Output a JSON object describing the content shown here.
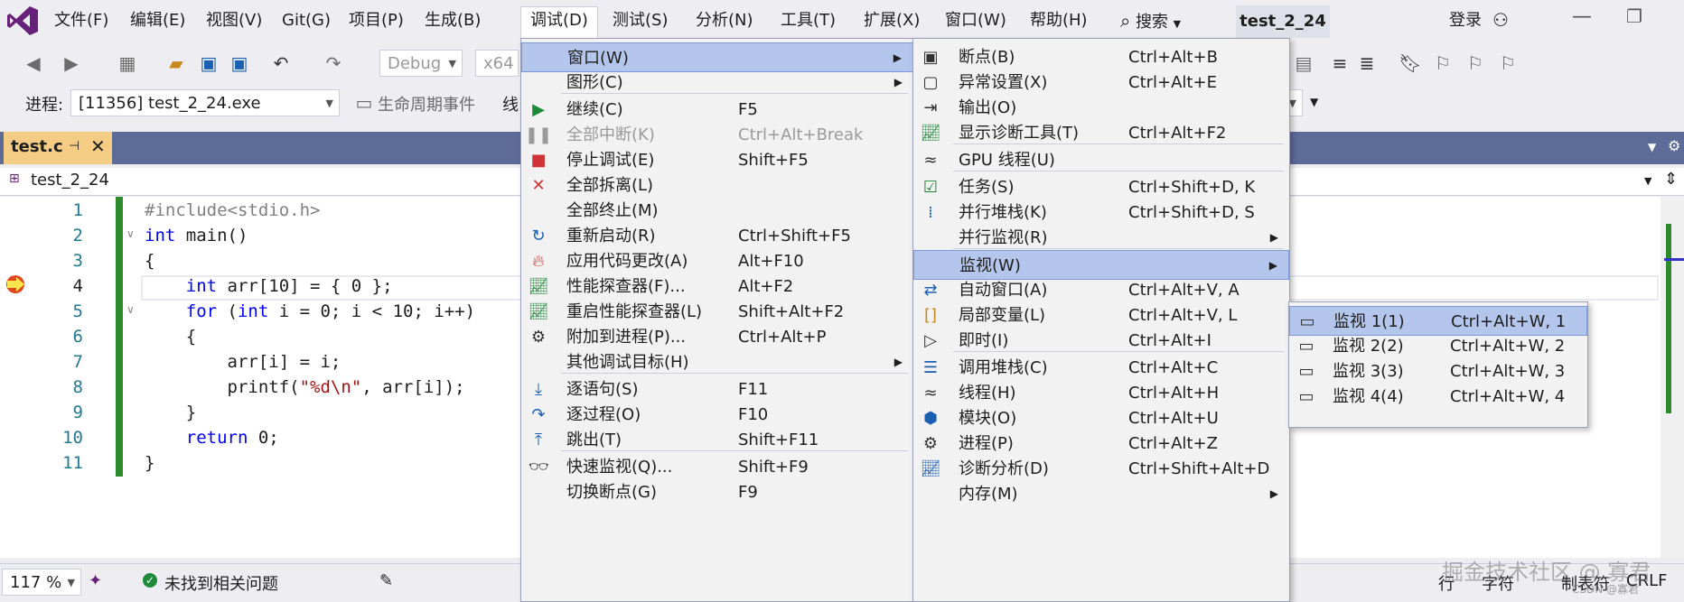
{
  "menubar": {
    "items": [
      "文件(F)",
      "编辑(E)",
      "视图(V)",
      "Git(G)",
      "项目(P)",
      "生成(B)",
      "调试(D)",
      "测试(S)",
      "分析(N)",
      "工具(T)",
      "扩展(X)",
      "窗口(W)",
      "帮助(H)"
    ],
    "search": "搜索",
    "title": "test_2_24",
    "login": "登录"
  },
  "toolbar": {
    "config": "Debug",
    "platform": "x64",
    "process_label": "进程:",
    "process": "[11356] test_2_24.exe",
    "lifecycle": "生命周期事件",
    "thread_label": "线"
  },
  "tab": {
    "title": "test.c"
  },
  "nav": {
    "scope": "test_2_24"
  },
  "code": {
    "line_numbers": [
      "1",
      "2",
      "3",
      "4",
      "5",
      "6",
      "7",
      "8",
      "9",
      "10",
      "11"
    ]
  },
  "status": {
    "zoom": "117 %",
    "issues": "未找到相关问题",
    "right_text": "行",
    "right_text2": "字符",
    "right_text3": "制表符",
    "eol": "CRLF",
    "watermark": "掘金技术社区 @ 寡君",
    "watermark2": "CSDN @寡君"
  },
  "debug_menu": {
    "items": [
      {
        "label": "窗口(W)",
        "shortcut": "",
        "icon": "",
        "submenu": true
      },
      {
        "label": "图形(C)",
        "shortcut": "",
        "icon": "",
        "submenu": true
      },
      {
        "label": "继续(C)",
        "shortcut": "F5",
        "icon": "play-icon"
      },
      {
        "label": "全部中断(K)",
        "shortcut": "Ctrl+Alt+Break",
        "icon": "pause-icon",
        "disabled": true
      },
      {
        "label": "停止调试(E)",
        "shortcut": "Shift+F5",
        "icon": "stop-icon"
      },
      {
        "label": "全部拆离(L)",
        "shortcut": "",
        "icon": "detach-icon"
      },
      {
        "label": "全部终止(M)",
        "shortcut": "",
        "icon": ""
      },
      {
        "label": "重新启动(R)",
        "shortcut": "Ctrl+Shift+F5",
        "icon": "restart-icon"
      },
      {
        "label": "应用代码更改(A)",
        "shortcut": "Alt+F10",
        "icon": "hot-reload-icon"
      },
      {
        "label": "性能探查器(F)...",
        "shortcut": "Alt+F2",
        "icon": "profiler-icon"
      },
      {
        "label": "重启性能探查器(L)",
        "shortcut": "Shift+Alt+F2",
        "icon": "profiler-icon"
      },
      {
        "label": "附加到进程(P)...",
        "shortcut": "Ctrl+Alt+P",
        "icon": "attach-icon"
      },
      {
        "label": "其他调试目标(H)",
        "shortcut": "",
        "icon": "",
        "submenu": true
      },
      {
        "label": "逐语句(S)",
        "shortcut": "F11",
        "icon": "step-into-icon"
      },
      {
        "label": "逐过程(O)",
        "shortcut": "F10",
        "icon": "step-over-icon"
      },
      {
        "label": "跳出(T)",
        "shortcut": "Shift+F11",
        "icon": "step-out-icon"
      },
      {
        "label": "快速监视(Q)...",
        "shortcut": "Shift+F9",
        "icon": "quickwatch-icon"
      },
      {
        "label": "切换断点(G)",
        "shortcut": "F9",
        "icon": ""
      }
    ]
  },
  "window_menu": {
    "items": [
      {
        "label": "断点(B)",
        "shortcut": "Ctrl+Alt+B",
        "icon": "breakpoints-icon"
      },
      {
        "label": "异常设置(X)",
        "shortcut": "Ctrl+Alt+E",
        "icon": "exception-icon"
      },
      {
        "label": "输出(O)",
        "shortcut": "",
        "icon": "output-icon"
      },
      {
        "label": "显示诊断工具(T)",
        "shortcut": "Ctrl+Alt+F2",
        "icon": "diagnostics-icon"
      },
      {
        "label": "GPU 线程(U)",
        "shortcut": "",
        "icon": "gpu-thread-icon"
      },
      {
        "label": "任务(S)",
        "shortcut": "Ctrl+Shift+D, K",
        "icon": "tasks-icon"
      },
      {
        "label": "并行堆栈(K)",
        "shortcut": "Ctrl+Shift+D, S",
        "icon": "parallel-stacks-icon"
      },
      {
        "label": "并行监视(R)",
        "shortcut": "",
        "icon": "",
        "submenu": true
      },
      {
        "label": "监视(W)",
        "shortcut": "",
        "icon": "",
        "submenu": true
      },
      {
        "label": "自动窗口(A)",
        "shortcut": "Ctrl+Alt+V, A",
        "icon": "autos-icon"
      },
      {
        "label": "局部变量(L)",
        "shortcut": "Ctrl+Alt+V, L",
        "icon": "locals-icon"
      },
      {
        "label": "即时(I)",
        "shortcut": "Ctrl+Alt+I",
        "icon": "immediate-icon"
      },
      {
        "label": "调用堆栈(C)",
        "shortcut": "Ctrl+Alt+C",
        "icon": "callstack-icon"
      },
      {
        "label": "线程(H)",
        "shortcut": "Ctrl+Alt+H",
        "icon": "threads-icon"
      },
      {
        "label": "模块(O)",
        "shortcut": "Ctrl+Alt+U",
        "icon": "modules-icon"
      },
      {
        "label": "进程(P)",
        "shortcut": "Ctrl+Alt+Z",
        "icon": "processes-icon"
      },
      {
        "label": "诊断分析(D)",
        "shortcut": "Ctrl+Shift+Alt+D",
        "icon": "diagnostic-analysis-icon"
      },
      {
        "label": "内存(M)",
        "shortcut": "",
        "icon": "",
        "submenu": true
      }
    ]
  },
  "watch_menu": {
    "items": [
      {
        "label": "监视 1(1)",
        "shortcut": "Ctrl+Alt+W, 1",
        "icon": "watch-icon"
      },
      {
        "label": "监视 2(2)",
        "shortcut": "Ctrl+Alt+W, 2",
        "icon": "watch-icon"
      },
      {
        "label": "监视 3(3)",
        "shortcut": "Ctrl+Alt+W, 3",
        "icon": "watch-icon"
      },
      {
        "label": "监视 4(4)",
        "shortcut": "Ctrl+Alt+W, 4",
        "icon": "watch-icon"
      }
    ]
  },
  "colors": {
    "accent": "#68217a",
    "menu_highlight": "#b5c6ec",
    "tab_active": "#f5cc84",
    "tabstrip": "#5d6b99"
  }
}
